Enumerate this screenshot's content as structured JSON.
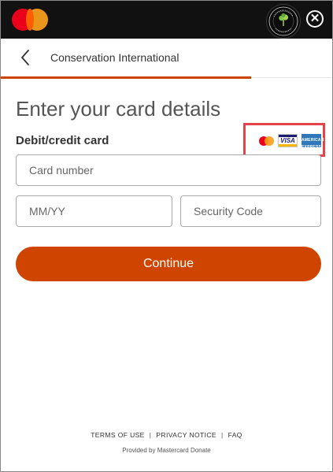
{
  "topbar": {
    "brand_logo": "mastercard-logo",
    "coalition_icon": "priceless-planet-coalition-icon",
    "close_icon": "close-icon"
  },
  "header": {
    "back_icon": "chevron-left-icon",
    "org_name": "Conservation International",
    "accent_color": "#cf4500"
  },
  "form": {
    "title": "Enter your card details",
    "section_label": "Debit/credit card",
    "accepted_cards": [
      "mastercard",
      "visa",
      "american-express"
    ],
    "visa_text": "VISA",
    "amex_text": "AMERICAN EXPRESS",
    "card_number_placeholder": "Card number",
    "expiry_placeholder": "MM/YY",
    "security_code_placeholder": "Security Code",
    "continue_label": "Continue"
  },
  "footer": {
    "links": [
      "TERMS OF USE",
      "PRIVACY NOTICE",
      "FAQ"
    ],
    "separator": "|",
    "provided_by": "Provided by Mastercard Donate"
  }
}
